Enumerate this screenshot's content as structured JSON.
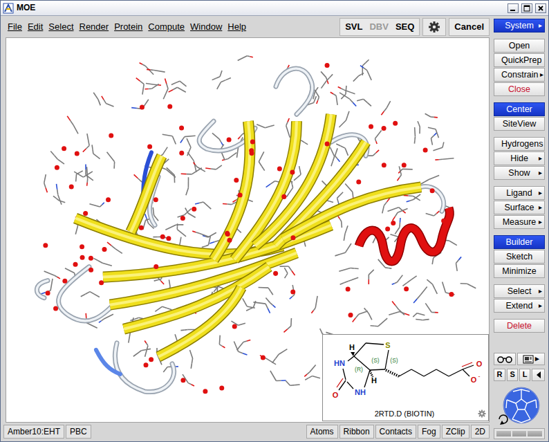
{
  "window": {
    "title": "MOE"
  },
  "menu": [
    "File",
    "Edit",
    "Select",
    "Render",
    "Protein",
    "Compute",
    "Window",
    "Help"
  ],
  "toolbar": {
    "items": [
      {
        "label": "SVL",
        "disabled": false
      },
      {
        "label": "DBV",
        "disabled": true
      },
      {
        "label": "SEQ",
        "disabled": false
      }
    ],
    "cancel": "Cancel"
  },
  "panel": {
    "groups": [
      [
        {
          "label": "System",
          "arrow": "▸",
          "kind": "highlight"
        }
      ],
      [
        {
          "label": "Open",
          "kind": "normal"
        },
        {
          "label": "QuickPrep",
          "kind": "normal"
        },
        {
          "label": "Constrain",
          "arrow": "▸",
          "kind": "normal"
        },
        {
          "label": "Close",
          "kind": "danger"
        }
      ],
      [
        {
          "label": "Center",
          "kind": "highlight"
        },
        {
          "label": "SiteView",
          "kind": "normal"
        }
      ],
      [
        {
          "label": "Hydrogens",
          "kind": "normal"
        },
        {
          "label": "Hide",
          "arrow": "▸",
          "kind": "normal"
        },
        {
          "label": "Show",
          "arrow": "▸",
          "kind": "normal"
        }
      ],
      [
        {
          "label": "Ligand",
          "arrow": "▸",
          "kind": "normal"
        },
        {
          "label": "Surface",
          "arrow": "▸",
          "kind": "normal"
        },
        {
          "label": "Measure",
          "arrow": "▸",
          "kind": "normal"
        }
      ],
      [
        {
          "label": "Builder",
          "kind": "highlight"
        },
        {
          "label": "Sketch",
          "kind": "normal"
        },
        {
          "label": "Minimize",
          "kind": "normal"
        }
      ],
      [
        {
          "label": "Select",
          "arrow": "▸",
          "kind": "normal"
        },
        {
          "label": "Extend",
          "arrow": "▸",
          "kind": "normal"
        }
      ],
      [
        {
          "label": "Delete",
          "kind": "danger"
        }
      ]
    ]
  },
  "view_tools": {
    "more": "▸",
    "views": [
      "R",
      "S",
      "L"
    ]
  },
  "sketch": {
    "labels": [
      {
        "text": "H",
        "color": "#000000"
      },
      {
        "text": "S",
        "color": "#8c8c00"
      },
      {
        "text": "HN",
        "color": "#1f3fcf"
      },
      {
        "text": "(R)",
        "color": "#2e7d32"
      },
      {
        "text": "(S)",
        "color": "#2e7d32"
      },
      {
        "text": "(S)",
        "color": "#2e7d32"
      },
      {
        "text": "H",
        "color": "#000000"
      },
      {
        "text": "NH",
        "color": "#1f3fcf"
      },
      {
        "text": "O",
        "color": "#d01010"
      },
      {
        "text": "O",
        "color": "#d01010"
      },
      {
        "text": "O",
        "color": "#d01010"
      }
    ],
    "charge": "-",
    "caption": "2RTD.D (BIOTIN)"
  },
  "status_bar": {
    "left": [
      "Amber10:EHT",
      "PBC"
    ],
    "right": [
      "Atoms",
      "Ribbon",
      "Contacts",
      "Fog",
      "ZClip",
      "2D"
    ]
  }
}
